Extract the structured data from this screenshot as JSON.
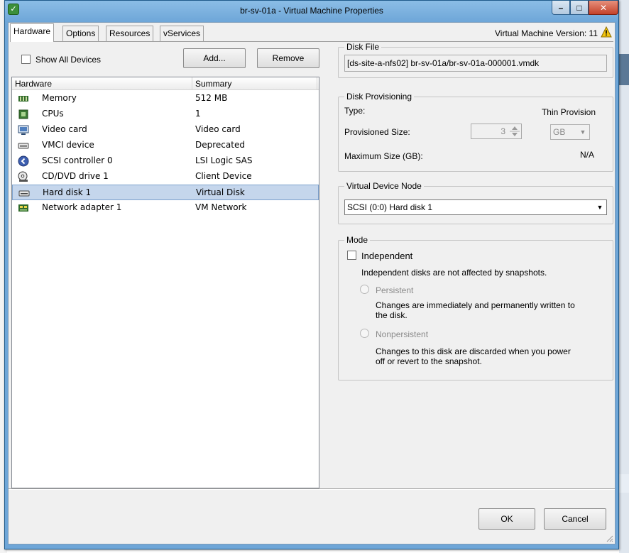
{
  "window": {
    "title": "br-sv-01a - Virtual Machine Properties",
    "minimize_glyph": "–",
    "maximize_glyph": "□",
    "close_glyph": "✕",
    "app_icon": "vsphere-client-icon"
  },
  "tabs": [
    {
      "label": "Hardware",
      "active": true
    },
    {
      "label": "Options",
      "active": false
    },
    {
      "label": "Resources",
      "active": false
    },
    {
      "label": "vServices",
      "active": false
    }
  ],
  "vm_version": "Virtual Machine Version: 11",
  "left": {
    "show_all_devices_label": "Show All Devices",
    "show_all_devices_checked": false,
    "add_button": "Add...",
    "remove_button": "Remove",
    "table": {
      "columns": [
        "Hardware",
        "Summary"
      ],
      "rows": [
        {
          "name": "Memory",
          "summary": "512 MB",
          "icon": "memory-icon"
        },
        {
          "name": "CPUs",
          "summary": "1",
          "icon": "cpu-icon"
        },
        {
          "name": "Video card",
          "summary": "Video card",
          "icon": "video-card-icon"
        },
        {
          "name": "VMCI device",
          "summary": "Deprecated",
          "icon": "vmci-device-icon"
        },
        {
          "name": "SCSI controller 0",
          "summary": "LSI Logic SAS",
          "icon": "scsi-controller-icon"
        },
        {
          "name": "CD/DVD drive 1",
          "summary": "Client Device",
          "icon": "cd-dvd-icon"
        },
        {
          "name": "Hard disk 1",
          "summary": "Virtual Disk",
          "icon": "hard-disk-icon",
          "selected": true
        },
        {
          "name": "Network adapter 1",
          "summary": "VM Network",
          "icon": "network-adapter-icon"
        }
      ]
    }
  },
  "disk_file": {
    "legend": "Disk File",
    "value": "[ds-site-a-nfs02] br-sv-01a/br-sv-01a-000001.vmdk"
  },
  "disk_provisioning": {
    "legend": "Disk Provisioning",
    "type_label": "Type:",
    "type_value": "Thin Provision",
    "provisioned_label": "Provisioned Size:",
    "provisioned_value": "3",
    "unit": "GB",
    "max_label": "Maximum Size (GB):",
    "max_value": "N/A"
  },
  "device_node": {
    "legend": "Virtual Device Node",
    "value": "SCSI (0:0) Hard disk 1"
  },
  "mode": {
    "legend": "Mode",
    "independent_label": "Independent",
    "independent_checked": false,
    "independent_desc": "Independent disks are not affected by snapshots.",
    "persistent_label": "Persistent",
    "persistent_desc_1": "Changes are immediately and permanently written to",
    "persistent_desc_2": "the disk.",
    "nonpersistent_label": "Nonpersistent",
    "nonpersistent_desc_1": "Changes to this disk are discarded when you power",
    "nonpersistent_desc_2": "off or revert to the snapshot."
  },
  "footer": {
    "ok_button": "OK",
    "cancel_button": "Cancel"
  }
}
